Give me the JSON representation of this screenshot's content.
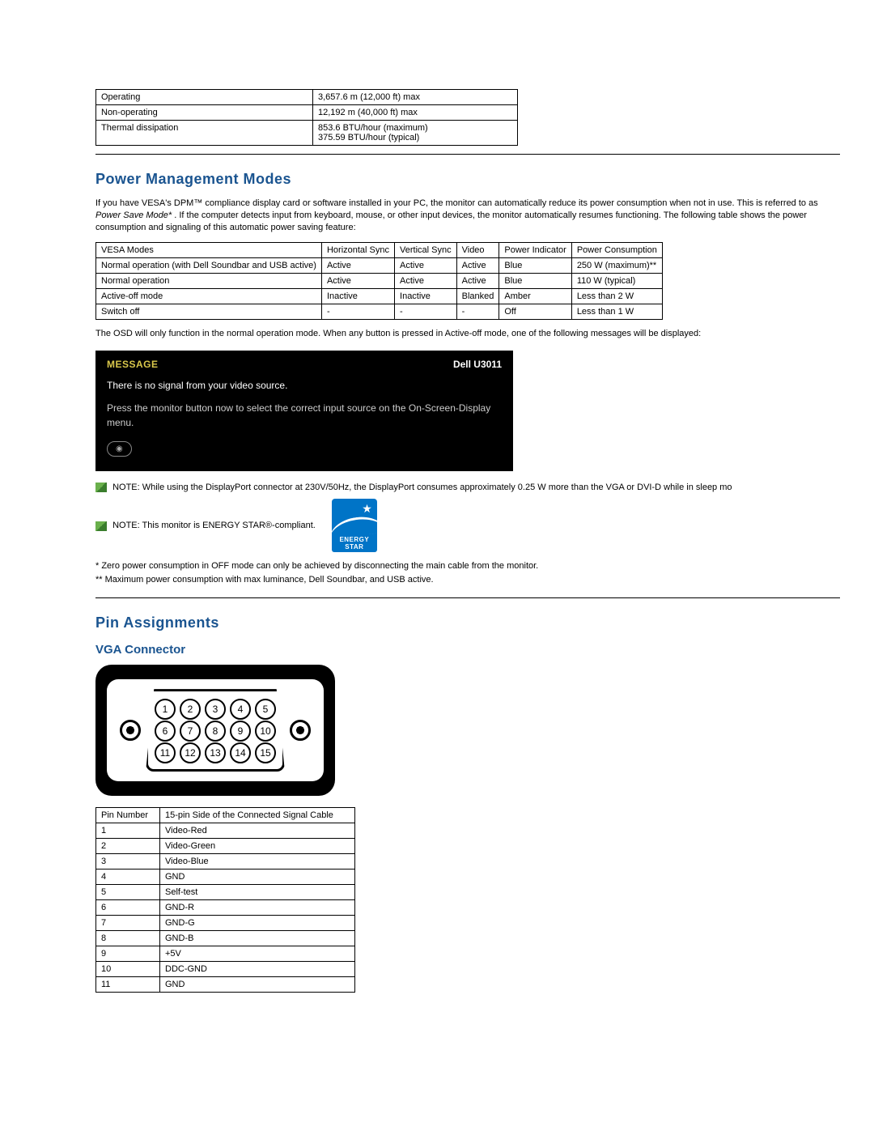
{
  "spec_table": {
    "rows": [
      {
        "label": "Operating",
        "value": "3,657.6 m (12,000 ft) max"
      },
      {
        "label": "Non-operating",
        "value": "12,192 m (40,000 ft) max"
      },
      {
        "label": "Thermal dissipation",
        "value": "853.6 BTU/hour (maximum)\n375.59 BTU/hour (typical)"
      }
    ]
  },
  "power_mgmt": {
    "heading": "Power Management Modes",
    "intro_part1": "If you have VESA's DPM™ compliance display card or software installed in your PC, the monitor can automatically reduce its power consumption when not in use. This is referred to as ",
    "intro_italic": "Power Save Mode*",
    "intro_part2": ". If the computer detects input from keyboard, mouse, or other input devices, the monitor automatically resumes functioning. The following table shows the power consumption and signaling of this automatic power saving feature:",
    "table_headers": [
      "VESA Modes",
      "Horizontal Sync",
      "Vertical Sync",
      "Video",
      "Power Indicator",
      "Power Consumption"
    ],
    "table_rows": [
      [
        "Normal operation (with Dell Soundbar and USB active)",
        "Active",
        "Active",
        "Active",
        "Blue",
        "250 W (maximum)**"
      ],
      [
        "Normal operation",
        "Active",
        "Active",
        "Active",
        "Blue",
        "110 W (typical)"
      ],
      [
        "Active-off mode",
        "Inactive",
        "Inactive",
        "Blanked",
        "Amber",
        "Less than 2 W"
      ],
      [
        "Switch off",
        "-",
        "-",
        "-",
        "Off",
        "Less than 1 W"
      ]
    ],
    "osd_note": "The OSD will only function in the normal operation mode. When any button is pressed in Active-off mode, one of the following messages will be displayed:",
    "osd": {
      "header_msg": "MESSAGE",
      "header_model": "Dell U3011",
      "line1": "There is no signal from your video source.",
      "line2": "Press the monitor button now to select the correct input source on the On-Screen-Display menu.",
      "button": "◉"
    },
    "note1": "NOTE: While using the DisplayPort connector at 230V/50Hz, the DisplayPort consumes approximately 0.25 W more than the VGA or DVI-D while in sleep mo",
    "note2": "NOTE: This monitor is ENERGY STAR®-compliant.",
    "energy_star_label": "ENERGY STAR",
    "footnote1": "*   Zero power consumption in OFF mode can only be achieved by disconnecting the main cable from the monitor.",
    "footnote2": "** Maximum power consumption with max luminance, Dell Soundbar, and USB active."
  },
  "pin_assign": {
    "heading": "Pin Assignments",
    "vga_heading": "VGA Connector",
    "diagram_pins_row1": [
      "1",
      "2",
      "3",
      "4",
      "5"
    ],
    "diagram_pins_row2": [
      "6",
      "7",
      "8",
      "9",
      "10"
    ],
    "diagram_pins_row3": [
      "11",
      "12",
      "13",
      "14",
      "15"
    ],
    "table_headers": [
      "Pin Number",
      "15-pin Side of the Connected Signal Cable"
    ],
    "table_rows": [
      [
        "1",
        "Video-Red"
      ],
      [
        "2",
        "Video-Green"
      ],
      [
        "3",
        "Video-Blue"
      ],
      [
        "4",
        "GND"
      ],
      [
        "5",
        "Self-test"
      ],
      [
        "6",
        "GND-R"
      ],
      [
        "7",
        "GND-G"
      ],
      [
        "8",
        "GND-B"
      ],
      [
        "9",
        "+5V"
      ],
      [
        "10",
        "DDC-GND"
      ],
      [
        "11",
        "GND"
      ]
    ]
  }
}
